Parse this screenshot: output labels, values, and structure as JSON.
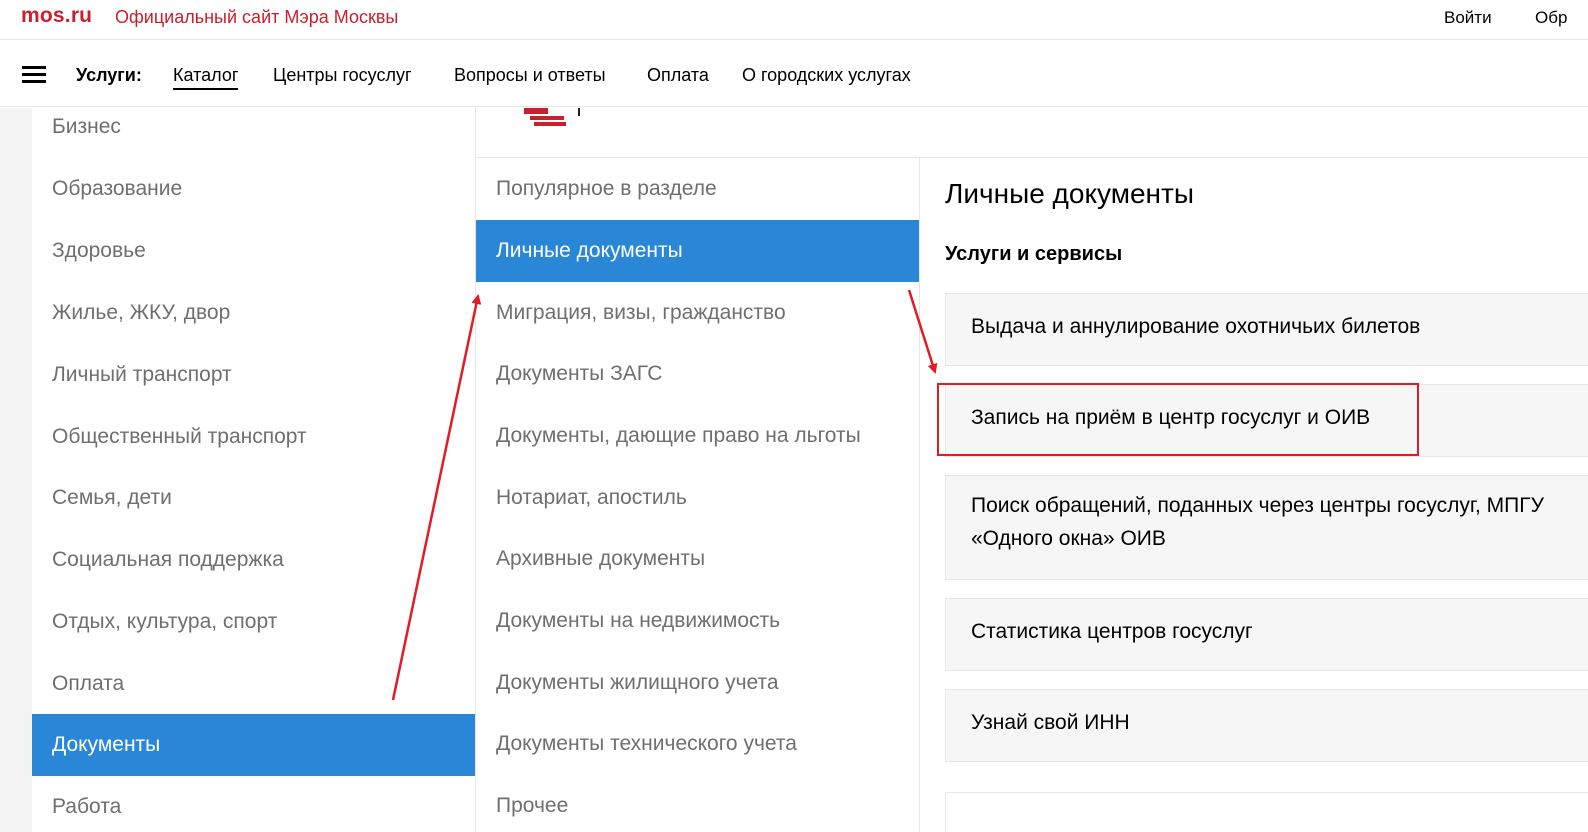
{
  "header": {
    "logo": "mos.ru",
    "site_title": "Официальный сайт Мэра Москвы",
    "login": "Войти",
    "cut_item": "Обр"
  },
  "nav": {
    "label": "Услуги:",
    "items": [
      {
        "label": "Каталог",
        "active": true
      },
      {
        "label": "Центры госуслуг"
      },
      {
        "label": "Вопросы и ответы"
      },
      {
        "label": "Оплата"
      },
      {
        "label": "О городских услугах"
      }
    ]
  },
  "categories": [
    {
      "label": "Бизнес"
    },
    {
      "label": "Образование"
    },
    {
      "label": "Здоровье"
    },
    {
      "label": "Жилье, ЖКУ, двор"
    },
    {
      "label": "Личный транспорт"
    },
    {
      "label": "Общественный транспорт"
    },
    {
      "label": "Семья, дети"
    },
    {
      "label": "Социальная поддержка"
    },
    {
      "label": "Отдых, культура, спорт"
    },
    {
      "label": "Оплата"
    },
    {
      "label": "Документы",
      "active": true
    },
    {
      "label": "Работа"
    }
  ],
  "subcategories": [
    {
      "label": "Популярное в разделе"
    },
    {
      "label": "Личные документы",
      "active": true
    },
    {
      "label": "Миграция, визы, гражданство"
    },
    {
      "label": "Документы ЗАГС"
    },
    {
      "label": "Документы, дающие право на льготы"
    },
    {
      "label": "Нотариат, апостиль"
    },
    {
      "label": "Архивные документы"
    },
    {
      "label": "Документы на недвижимость"
    },
    {
      "label": "Документы жилищного учета"
    },
    {
      "label": "Документы технического учета"
    },
    {
      "label": "Прочее"
    }
  ],
  "content": {
    "title": "Личные документы",
    "subtitle": "Услуги и сервисы",
    "services": [
      {
        "lines": [
          "Выдача и аннулирование охотничьих билетов"
        ]
      },
      {
        "lines": [
          "Запись на приём в центр госуслуг и ОИВ"
        ],
        "highlighted": true
      },
      {
        "lines": [
          "Поиск обращений, поданных через центры госуслуг, МПГУ",
          "«Одного окна» ОИВ"
        ]
      },
      {
        "lines": [
          "Статистика центров госуслуг"
        ]
      },
      {
        "lines": [
          "Узнай свой ИНН"
        ]
      }
    ]
  },
  "colors": {
    "brand_red": "#cc1e2b",
    "active_blue": "#2a87d8",
    "annotation_red": "#e31b23"
  }
}
